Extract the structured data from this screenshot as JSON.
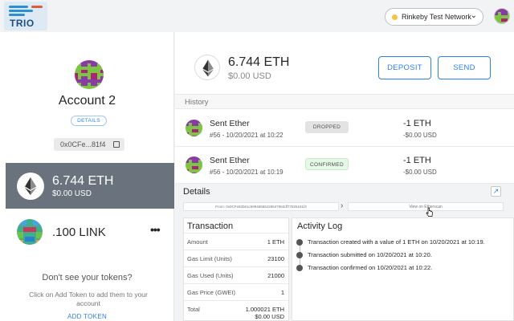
{
  "header": {
    "logo_text": "TRIO",
    "network_name": "Rinkeby Test Network",
    "network_dot_color": "#f6c343",
    "network_icon": "chevron-down-icon",
    "account_icon": "identicon"
  },
  "sidebar": {
    "account_name": "Account 2",
    "details_label": "DETAILS",
    "address_short": "0x0CFe...81f4",
    "copy_icon": "copy-icon",
    "tokens": [
      {
        "amount": "6.744 ETH",
        "fiat": "$0.00 USD",
        "icon": "ethereum-icon",
        "selected": true
      },
      {
        "amount": ".100 LINK",
        "icon": "token-identicon",
        "selected": false
      }
    ],
    "more_icon": "more-dots-icon",
    "dont_see": "Don't see your tokens?",
    "add_hint": "Click on Add Token to add them to your account",
    "add_token_label": "ADD TOKEN"
  },
  "main": {
    "balance_amount": "6.744 ETH",
    "balance_fiat": "$0.00 USD",
    "deposit_label": "DEPOSIT",
    "send_label": "SEND",
    "history_label": "History",
    "transactions": [
      {
        "title": "Sent Ether",
        "subtitle": "#56 - 10/20/2021 at 10:22",
        "status": "DROPPED",
        "value": "-1 ETH",
        "fiat": "-$0.00 USD"
      },
      {
        "title": "Sent Ether",
        "subtitle": "#56 - 10/20/2021 at 10:19",
        "status": "CONFIRMED",
        "value": "-1 ETH",
        "fiat": "-$0.00 USD"
      }
    ],
    "details": {
      "title": "Details",
      "expand_icon": "external-link-icon",
      "from_text": "From: 0x0CFe82b61c69946565429647962df77826181f4",
      "view_on_label": "View on Etherscan",
      "transaction": {
        "title": "Transaction",
        "rows": [
          {
            "key": "Amount",
            "value": "1 ETH"
          },
          {
            "key": "Gas Limit (Units)",
            "value": "23100"
          },
          {
            "key": "Gas Used (Units)",
            "value": "21000"
          },
          {
            "key": "Gas Price (GWEI)",
            "value": "1"
          },
          {
            "key": "Total",
            "value": "1.000021 ETH",
            "value2": "$0.00 USD"
          }
        ]
      },
      "activity": {
        "title": "Activity Log",
        "items": [
          "Transaction created with a value of 1 ETH on 10/20/2021 at 10:19.",
          "Transaction submitted on 10/20/2021 at 10:20.",
          "Transaction confirmed on 10/20/2021 at 10:22."
        ]
      }
    }
  },
  "colors": {
    "accent": "#2f80ed",
    "selected_card": "#6a737d",
    "confirmed_bg": "#e6f8e6",
    "dropped_bg": "#e3e3e3"
  }
}
